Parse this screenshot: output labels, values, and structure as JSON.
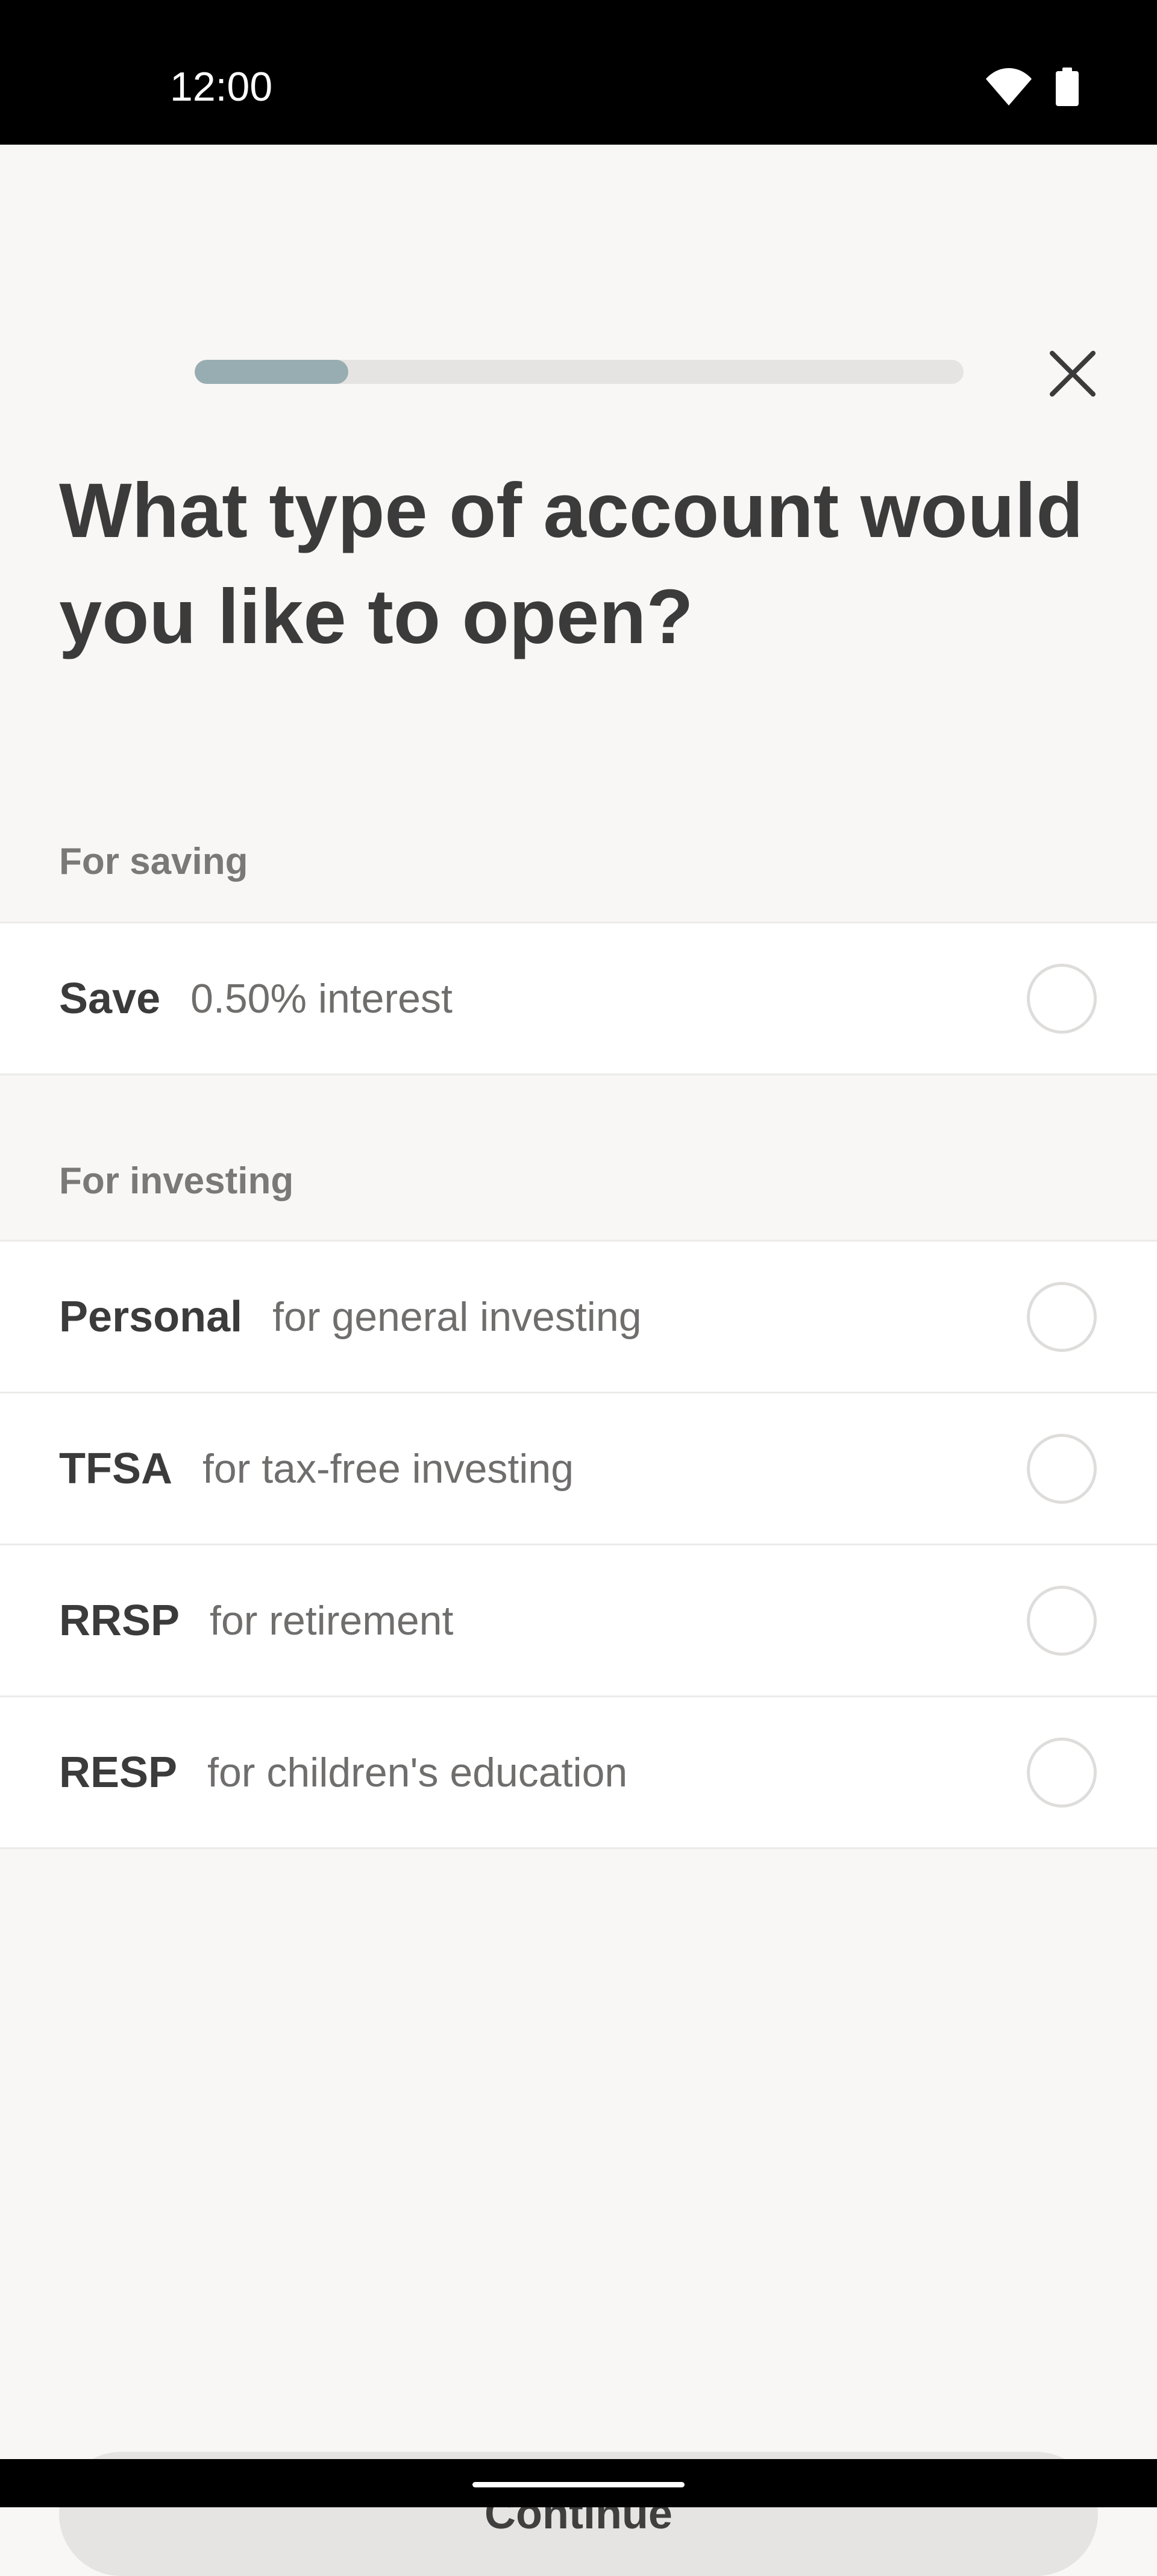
{
  "status_bar": {
    "time": "12:00",
    "icons": [
      "wifi-icon",
      "battery-icon"
    ]
  },
  "onboarding": {
    "progress_fraction": 0.2,
    "progress_color": "#98adb1",
    "close_icon": "close-icon",
    "title": "What type of account would you like to open?"
  },
  "sections": [
    {
      "header": "For saving",
      "options": [
        {
          "name": "Save",
          "description": "0.50% interest",
          "selected": false
        }
      ]
    },
    {
      "header": "For investing",
      "options": [
        {
          "name": "Personal",
          "description": "for general investing",
          "selected": false
        },
        {
          "name": "TFSA",
          "description": "for tax-free investing",
          "selected": false
        },
        {
          "name": "RRSP",
          "description": "for retirement",
          "selected": false
        },
        {
          "name": "RESP",
          "description": "for children's education",
          "selected": false
        }
      ]
    }
  ],
  "footer": {
    "continue_label": "Continue"
  },
  "colors": {
    "background": "#f8f7f5",
    "text": "#3b3b3b",
    "muted_text": "#7a7978",
    "divider": "#ecebea",
    "button_background": "#e5e4e2"
  }
}
